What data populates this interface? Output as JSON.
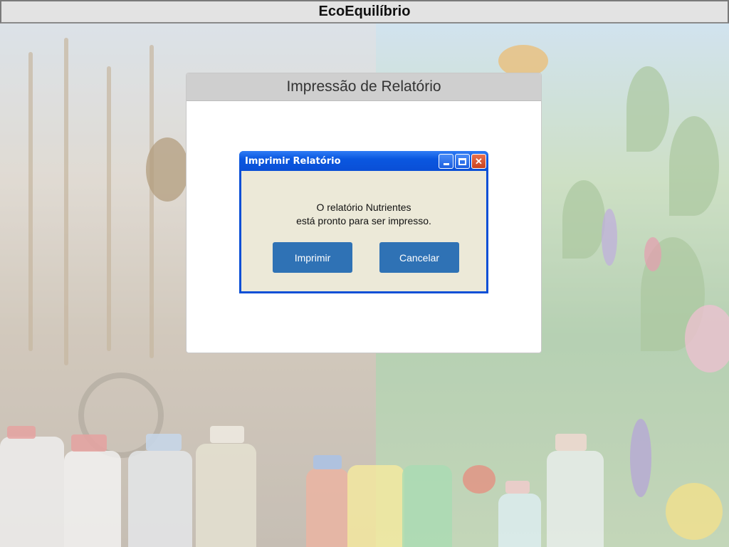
{
  "app": {
    "title": "EcoEquilíbrio"
  },
  "panel": {
    "title": "Impressão de Relatório"
  },
  "dialog": {
    "title": "Imprimir Relatório",
    "message_line1": "O relatório Nutrientes",
    "message_line2": "está pronto para ser impresso.",
    "print_label": "Imprimir",
    "cancel_label": "Cancelar",
    "window_controls": [
      "minimize-icon",
      "maximize-icon",
      "close-icon"
    ]
  },
  "colors": {
    "titlebar_bg": "#e3e3e3",
    "dialog_titlebar": "#0a4fd6",
    "dialog_body": "#ece9d8",
    "button_bg": "#2f72b5",
    "close_button": "#c9421f"
  }
}
